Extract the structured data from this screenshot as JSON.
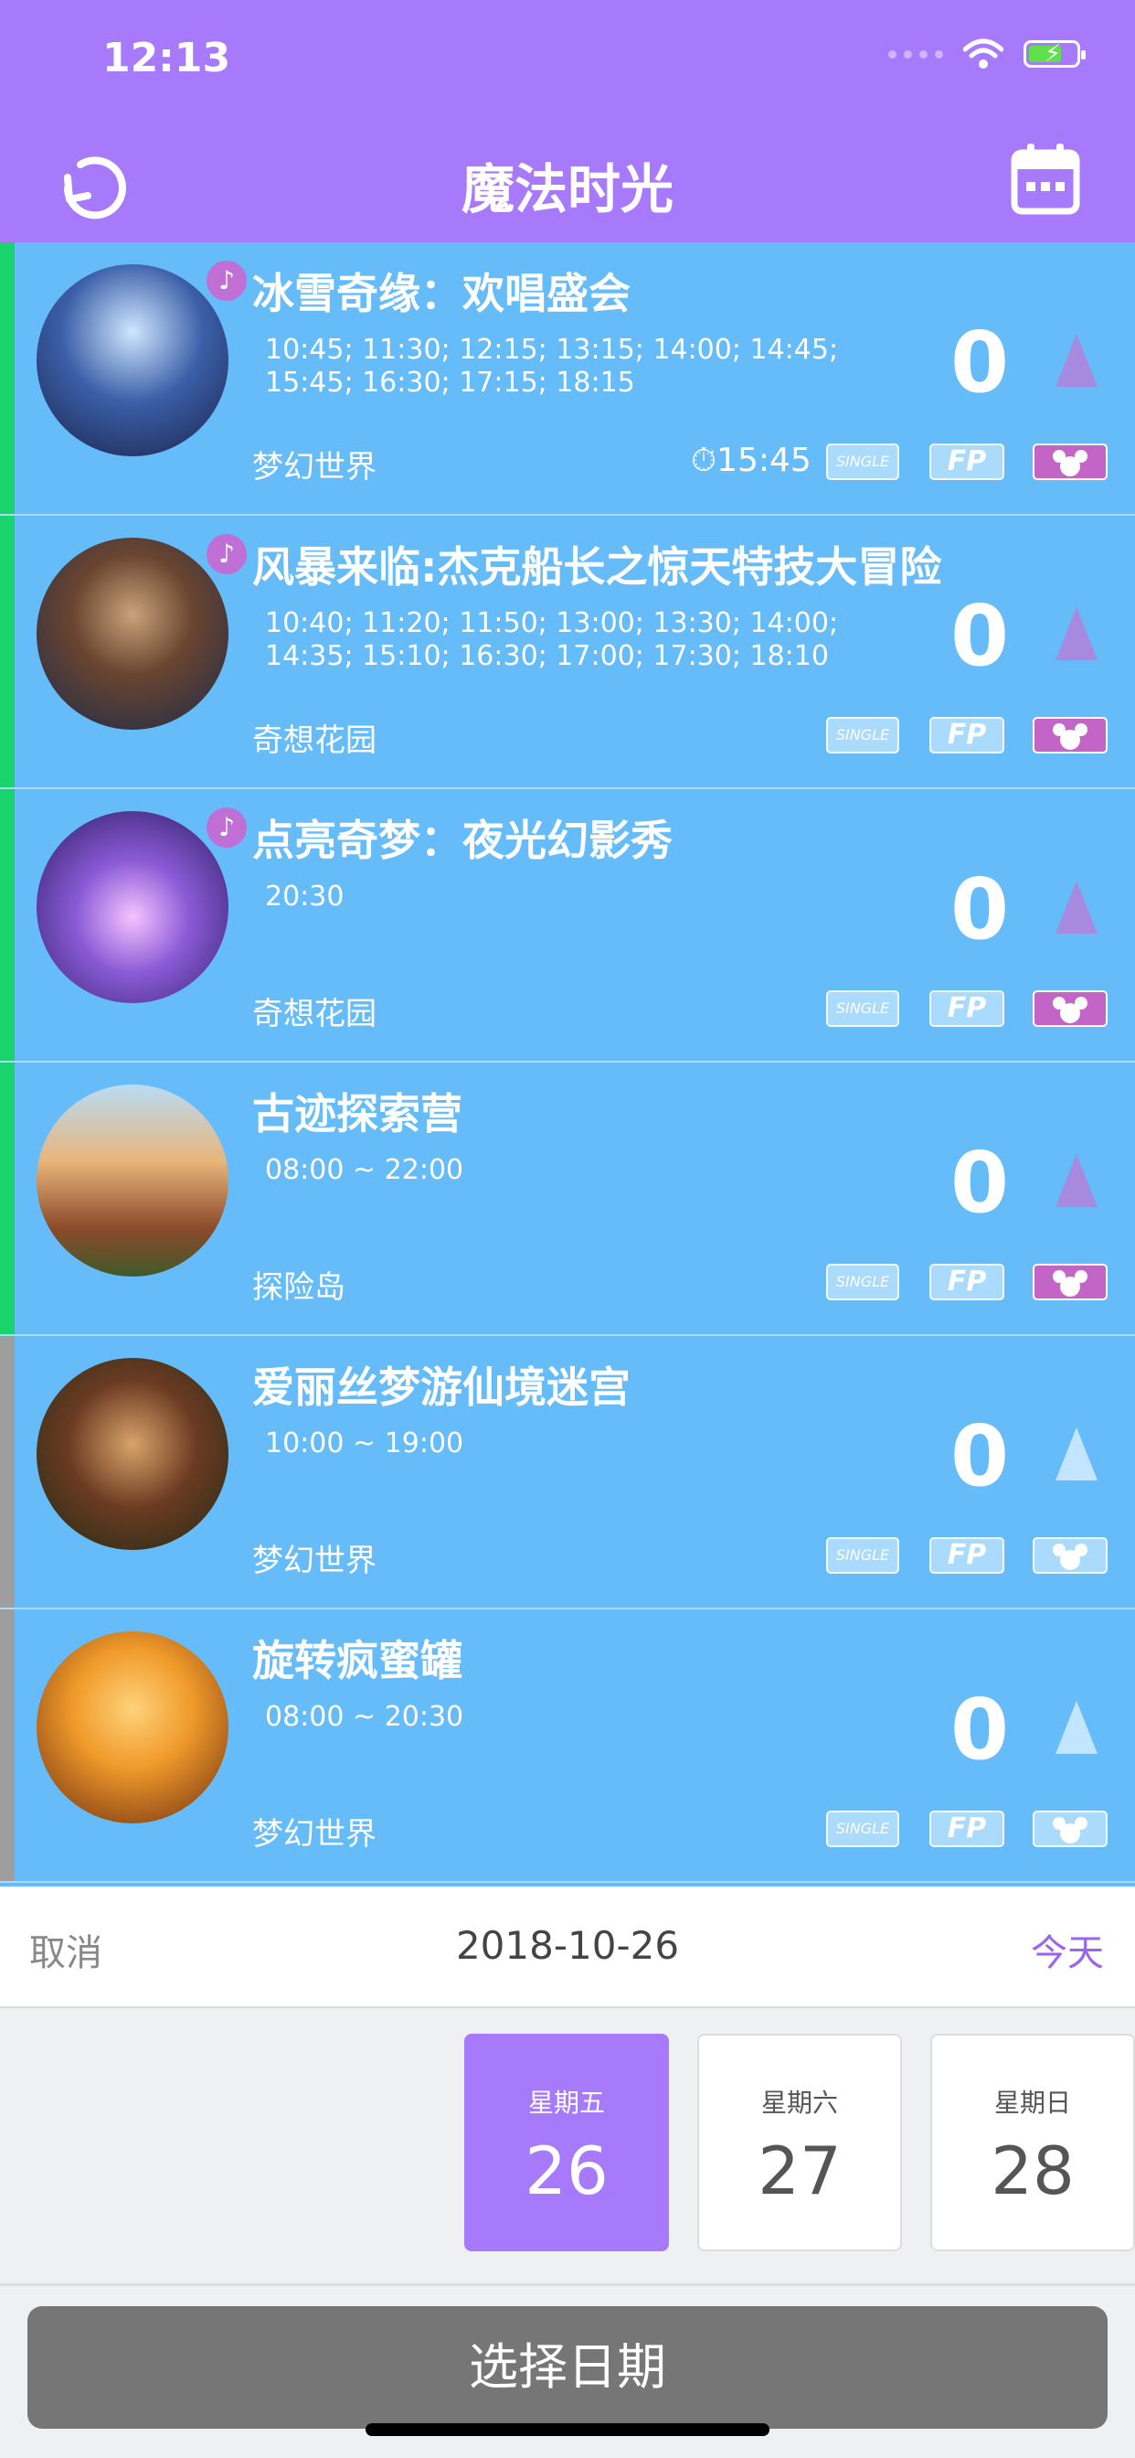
{
  "status": {
    "time": "12:13"
  },
  "header": {
    "title": "魔法时光"
  },
  "attractions": [
    {
      "name": "冰雪奇缘：欢唱盛会",
      "times": "10:45; 11:30; 12:15; 13:15; 14:00; 14:45; 15:45; 16:30; 17:15; 18:15",
      "park": "梦幻世界",
      "wait": "0",
      "fastpass_time": "15:45",
      "show": true
    },
    {
      "name": "风暴来临:杰克船长之惊天特技大冒险",
      "times": "10:40; 11:20; 11:50; 13:00; 13:30; 14:00; 14:35; 15:10; 16:30; 17:00; 17:30; 18:10",
      "park": "奇想花园",
      "wait": "0",
      "show": true
    },
    {
      "name": "点亮奇梦：夜光幻影秀",
      "times": "20:30",
      "park": "奇想花园",
      "wait": "0",
      "show": true
    },
    {
      "name": "古迹探索营",
      "times": "08:00 ~ 22:00",
      "park": "探险岛",
      "wait": "0",
      "show": false
    },
    {
      "name": "爱丽丝梦游仙境迷宫",
      "times": "10:00 ~ 19:00",
      "park": "梦幻世界",
      "wait": "0",
      "show": false
    },
    {
      "name": "旋转疯蜜罐",
      "times": "08:00 ~ 20:30",
      "park": "梦幻世界",
      "wait": "0",
      "show": false
    }
  ],
  "badges": {
    "single": "SINGLE",
    "fp": "FP"
  },
  "picker": {
    "cancel": "取消",
    "date": "2018-10-26",
    "today": "今天",
    "days": [
      {
        "weekday": "星期五",
        "day": "26"
      },
      {
        "weekday": "星期六",
        "day": "27"
      },
      {
        "weekday": "星期日",
        "day": "28"
      }
    ],
    "confirm": "选择日期"
  },
  "colors": {
    "header": "#a77afb",
    "list": "#65bcf9",
    "open_strip": "#19d36b",
    "closed_strip": "#9e9e9e",
    "accent": "#9b63f2"
  }
}
